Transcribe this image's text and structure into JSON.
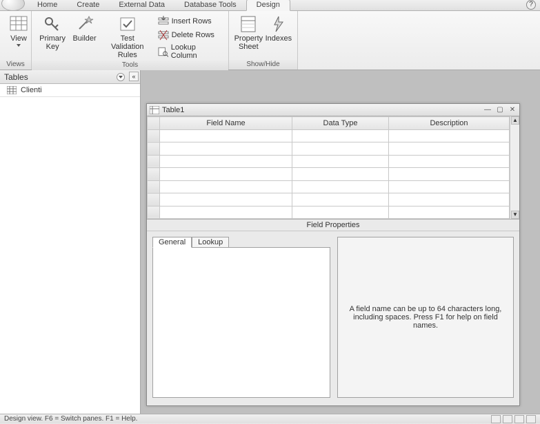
{
  "ribbon": {
    "tabs": [
      "Home",
      "Create",
      "External Data",
      "Database Tools",
      "Design"
    ],
    "active_tab": "Design",
    "groups": {
      "views": {
        "label": "Views",
        "view_btn": "View"
      },
      "tools": {
        "label": "Tools",
        "primary_key": "Primary Key",
        "builder": "Builder",
        "test_rules": "Test Validation Rules",
        "insert_rows": "Insert Rows",
        "delete_rows": "Delete Rows",
        "lookup_column": "Lookup Column"
      },
      "showhide": {
        "label": "Show/Hide",
        "property_sheet": "Property Sheet",
        "indexes": "Indexes"
      }
    }
  },
  "nav": {
    "header": "Tables",
    "items": [
      {
        "label": "Clienti"
      }
    ]
  },
  "design_window": {
    "title": "Table1",
    "columns": {
      "field_name": "Field Name",
      "data_type": "Data Type",
      "description": "Description"
    },
    "rows": [
      {
        "field_name": "",
        "data_type": "",
        "description": "",
        "editing": true
      },
      {
        "field_name": "",
        "data_type": "",
        "description": ""
      },
      {
        "field_name": "",
        "data_type": "",
        "description": ""
      },
      {
        "field_name": "",
        "data_type": "",
        "description": ""
      },
      {
        "field_name": "",
        "data_type": "",
        "description": ""
      },
      {
        "field_name": "",
        "data_type": "",
        "description": ""
      },
      {
        "field_name": "",
        "data_type": "",
        "description": ""
      }
    ],
    "field_properties_label": "Field Properties",
    "tabs": {
      "general": "General",
      "lookup": "Lookup"
    },
    "help_text": "A field name can be up to 64 characters long, including spaces.  Press F1 for help on field names."
  },
  "status_bar": "Design view.  F6 = Switch panes.  F1 = Help."
}
